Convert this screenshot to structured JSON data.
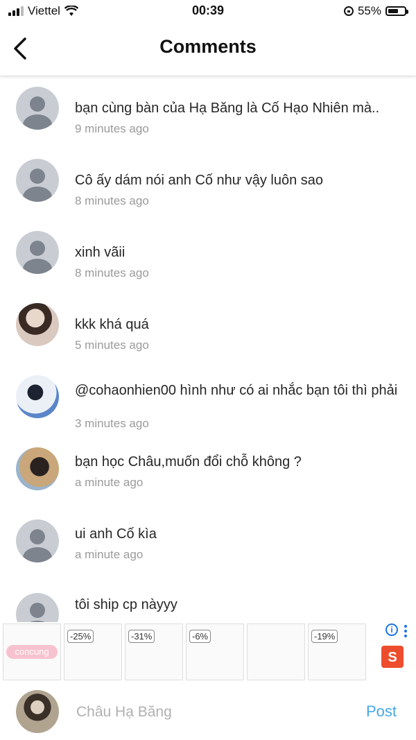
{
  "status_bar": {
    "carrier": "Viettel",
    "time": "00:39",
    "battery": "55%"
  },
  "header": {
    "title": "Comments"
  },
  "comments": [
    {
      "text": "bạn cùng bàn của Hạ Băng là Cố Hạo Nhiên mà..",
      "time": "9 minutes ago"
    },
    {
      "text": "Cô ấy dám nói anh Cố như vậy luôn sao",
      "time": "8 minutes ago"
    },
    {
      "text": "xinh vãii",
      "time": "8 minutes ago"
    },
    {
      "text": "kkk khá quá",
      "time": "5 minutes ago"
    },
    {
      "text": "@cohaonhien00 hình như có ai nhắc bạn tôi thì phải",
      "time": "3 minutes ago"
    },
    {
      "text": "bạn học Châu,muốn đổi chỗ không ?",
      "time": "a minute ago"
    },
    {
      "text": "ui anh Cố kìa",
      "time": "a minute ago"
    },
    {
      "text": "tôi ship cp nàyyy",
      "time": ""
    }
  ],
  "ad": {
    "brand": "concung",
    "discounts": [
      "-25%",
      "-31%",
      "-6%",
      "-19%"
    ],
    "shop_badge": "S"
  },
  "input": {
    "placeholder": "Châu Hạ Băng",
    "post_label": "Post"
  }
}
